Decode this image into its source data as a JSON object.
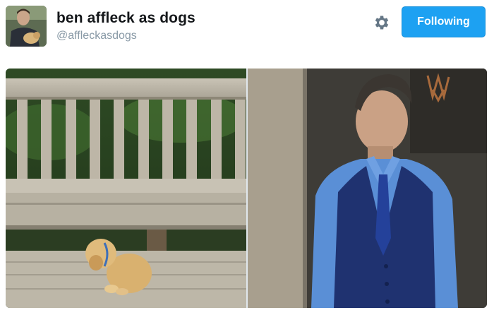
{
  "profile": {
    "display_name": "ben affleck as dogs",
    "handle": "@affleckasdogs",
    "avatar_icon": "profile-photo"
  },
  "actions": {
    "settings_icon": "gear-icon",
    "follow_label": "Following"
  },
  "media": {
    "photos": [
      {
        "subject": "puppy on wooden bench"
      },
      {
        "subject": "man in blue vest looking down"
      }
    ]
  },
  "colors": {
    "accent": "#1da1f2",
    "name_text": "#14171a",
    "handle_text": "#8899a6"
  }
}
